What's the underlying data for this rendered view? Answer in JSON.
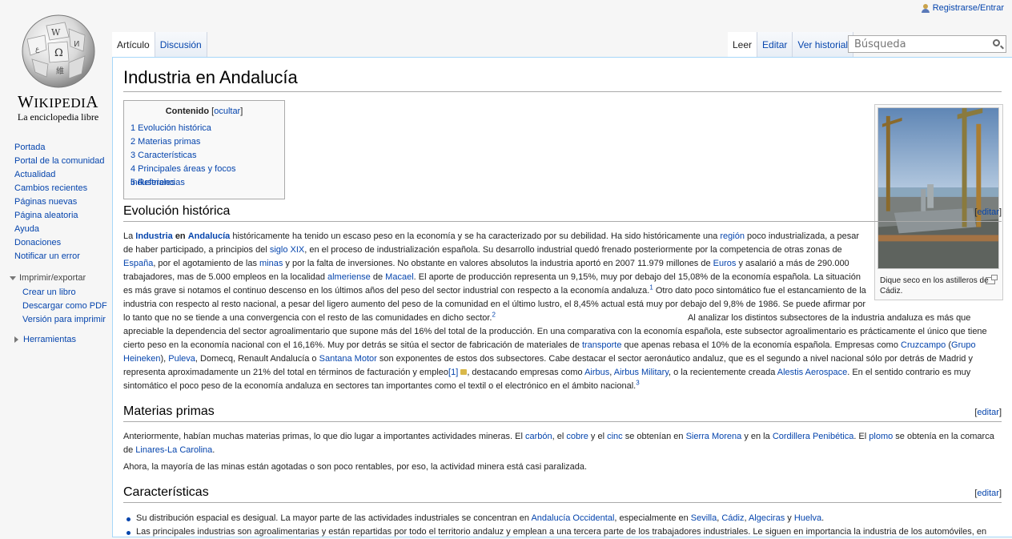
{
  "personal": {
    "login": "Registrarse/Entrar"
  },
  "logo": {
    "wordmark": "Wikipedia",
    "tagline": "La enciclopedia libre"
  },
  "nav": {
    "main": [
      "Portada",
      "Portal de la comunidad",
      "Actualidad",
      "Cambios recientes",
      "Páginas nuevas",
      "Página aleatoria",
      "Ayuda",
      "Donaciones",
      "Notificar un error"
    ],
    "print_head": "Imprimir/exportar",
    "print": [
      "Crear un libro",
      "Descargar como PDF",
      "Versión para imprimir"
    ],
    "tools": "Herramientas"
  },
  "tabs": {
    "article": "Artículo",
    "talk": "Discusión",
    "read": "Leer",
    "edit": "Editar",
    "history": "Ver historial"
  },
  "search": {
    "placeholder": "Búsqueda"
  },
  "article": {
    "title": "Industria en Andalucía",
    "toc": {
      "title": "Contenido",
      "hide": "ocultar",
      "items": [
        "1 Evolución histórica",
        "2 Materias primas",
        "3 Características",
        "4 Principales áreas y focos industriales",
        "5 Referencias"
      ]
    },
    "thumb_caption": "Dique seco en los astilleros de Cádiz.",
    "edit_label": "editar",
    "sections": {
      "s1": "Evolución histórica",
      "s2": "Materias primas",
      "s3": "Características"
    },
    "bullet1": {
      "pre": "Su distribución espacial es desigual. La mayor parte de las actividades industriales se concentran en ",
      "l1": "Andalucía Occidental",
      "mid": ", especialmente en ",
      "l2": "Sevilla",
      "c1": ", ",
      "l3": "Cádiz",
      "c2": ", ",
      "l4": "Algeciras",
      "c3": " y ",
      "l5": "Huelva",
      "end": "."
    },
    "bullet2": "Las principales industrias son agroalimentarias y están repartidas por todo el territorio andaluz y emplean a una tercera parte de los trabajadores industriales. Le siguen en importancia la industria de los automóviles, en"
  },
  "colors": {
    "link": "#0645ad",
    "border": "#a7d7f9",
    "background": "#f6f6f6"
  },
  "icons": [
    "user-icon",
    "wikipedia-globe-logo",
    "search-icon",
    "magnify-icon",
    "lock-icon"
  ]
}
